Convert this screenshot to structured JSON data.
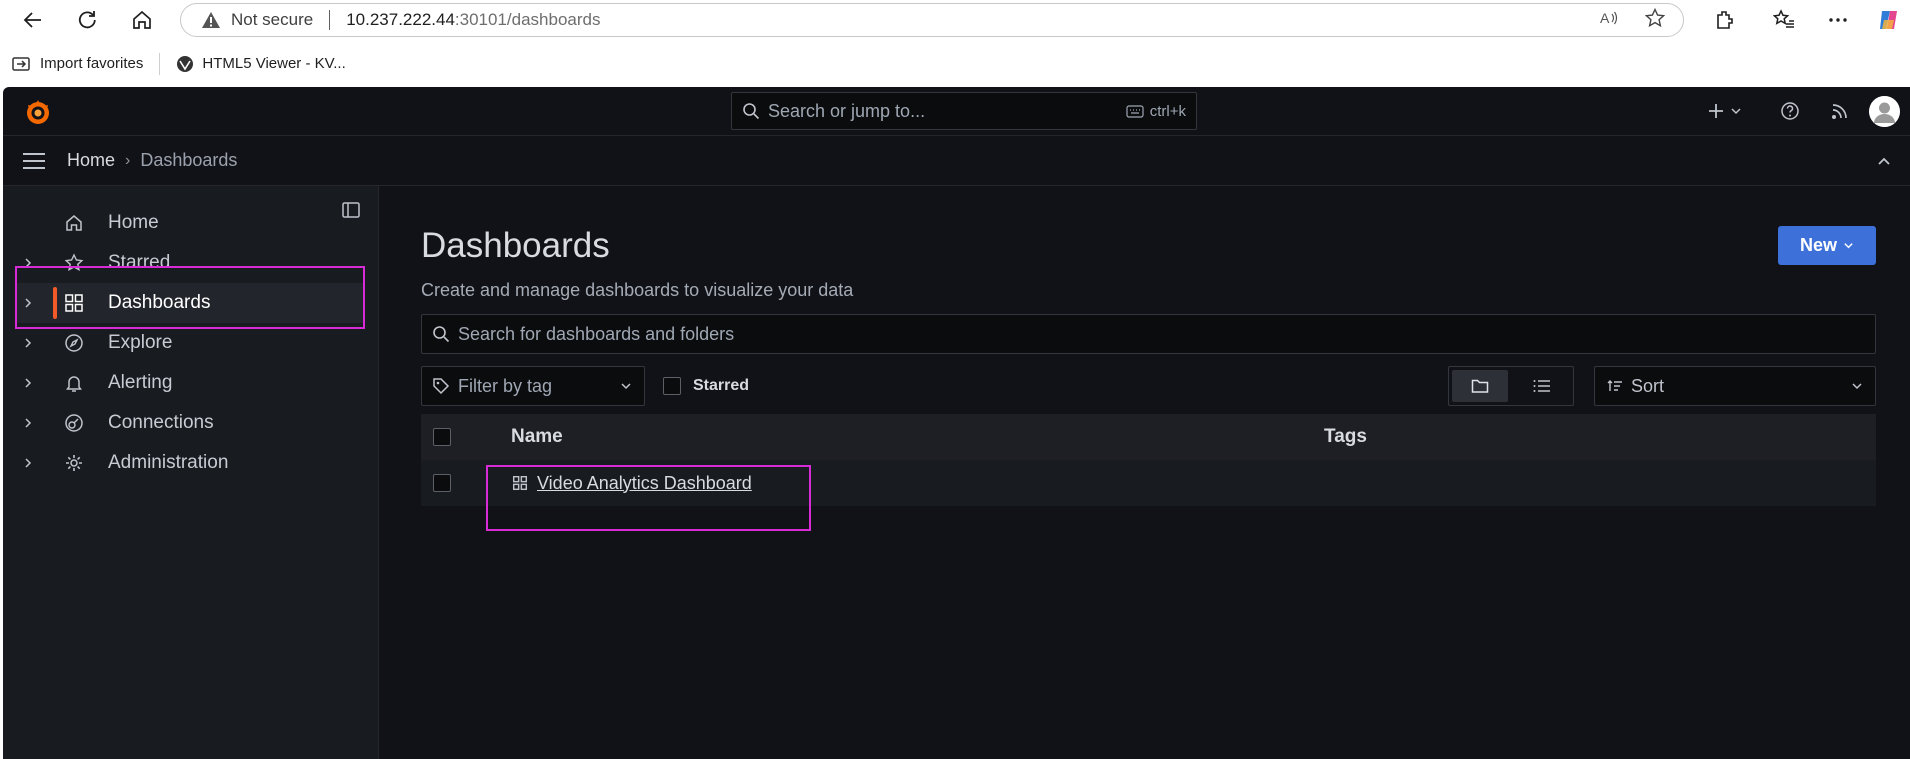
{
  "browser": {
    "security_label": "Not secure",
    "url_host": "10.237.222.44",
    "url_path": ":30101/dashboards",
    "bookmarks": [
      {
        "label": "Import favorites"
      },
      {
        "label": "HTML5 Viewer - KV..."
      }
    ]
  },
  "topbar": {
    "search_placeholder": "Search or jump to...",
    "search_shortcut": "ctrl+k"
  },
  "breadcrumb": {
    "home": "Home",
    "current": "Dashboards"
  },
  "sidebar": {
    "items": [
      {
        "label": "Home",
        "icon": "home-icon"
      },
      {
        "label": "Starred",
        "icon": "star-icon"
      },
      {
        "label": "Dashboards",
        "icon": "grid-icon",
        "active": true
      },
      {
        "label": "Explore",
        "icon": "compass-icon"
      },
      {
        "label": "Alerting",
        "icon": "bell-icon"
      },
      {
        "label": "Connections",
        "icon": "connections-icon"
      },
      {
        "label": "Administration",
        "icon": "gear-icon"
      }
    ]
  },
  "main": {
    "title": "Dashboards",
    "subtitle": "Create and manage dashboards to visualize your data",
    "new_button": "New",
    "search_placeholder": "Search for dashboards and folders",
    "tag_filter_placeholder": "Filter by tag",
    "starred_label": "Starred",
    "sort_label": "Sort",
    "table": {
      "columns": [
        "Name",
        "Tags"
      ],
      "rows": [
        {
          "name": "Video Analytics Dashboard",
          "tags": ""
        }
      ]
    }
  },
  "colors": {
    "accent": "#f05a28",
    "primary_button": "#3d71d9",
    "highlight": "#d62bd6",
    "background": "#111217"
  }
}
